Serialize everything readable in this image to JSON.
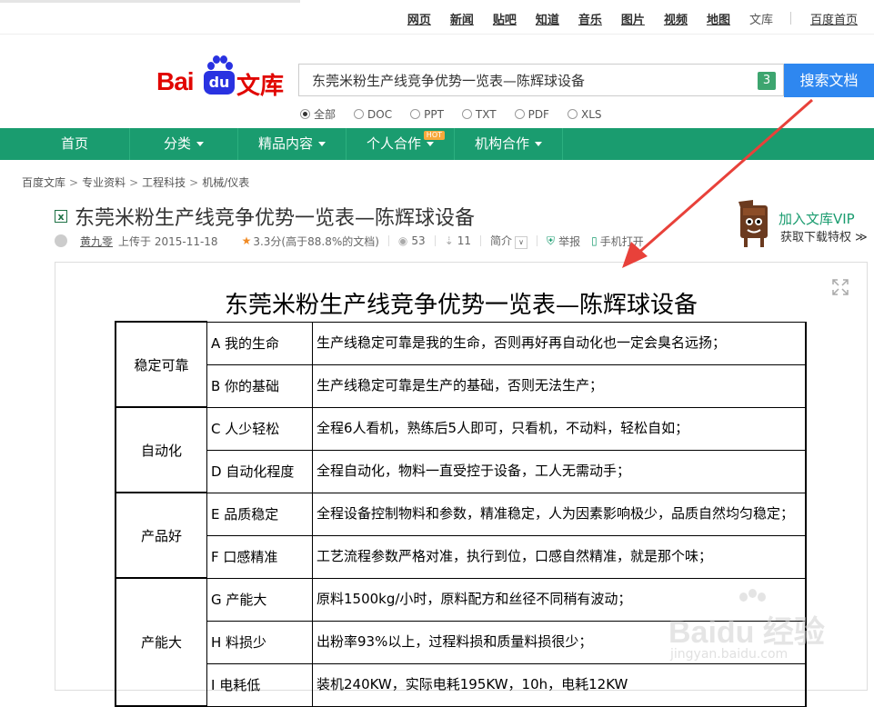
{
  "topnav": {
    "links": [
      "网页",
      "新闻",
      "贴吧",
      "知道",
      "音乐",
      "图片",
      "视频",
      "地图"
    ],
    "wenku": "文库",
    "baidu_home": "百度首页"
  },
  "logo": {
    "bai": "Bai",
    "du": "du",
    "wenku": "文库"
  },
  "search": {
    "value": "东莞米粉生产线竞争优势一览表—陈辉球设备",
    "badge": "3",
    "button": "搜索文档"
  },
  "filters": [
    {
      "label": "全部",
      "checked": true
    },
    {
      "label": "DOC",
      "checked": false
    },
    {
      "label": "PPT",
      "checked": false
    },
    {
      "label": "TXT",
      "checked": false
    },
    {
      "label": "PDF",
      "checked": false
    },
    {
      "label": "XLS",
      "checked": false
    }
  ],
  "greennav": {
    "home": "首页",
    "category": "分类",
    "featured": "精品内容",
    "personal": "个人合作",
    "hot_badge": "HOT",
    "org": "机构合作"
  },
  "breadcrumb": [
    "百度文库",
    "专业资料",
    "工程科技",
    "机械/仪表"
  ],
  "doc": {
    "type_icon": "x",
    "title": "东莞米粉生产线竞争优势一览表—陈辉球设备",
    "author": "黄九零",
    "uploaded": "上传于 2015-11-18",
    "rating": "3.3分(高于88.8%的文档)",
    "views": "53",
    "downloads": "11",
    "intro": "简介",
    "report": "举报",
    "mobile": "手机打开"
  },
  "vip": {
    "title": "加入文库VIP",
    "subtitle": "获取下载特权 ≫"
  },
  "sheet": {
    "title": "东莞米粉生产线竞争优势一览表—陈辉球设备",
    "groups": [
      {
        "category": "稳定可靠",
        "rows": [
          {
            "item": "A 我的生命",
            "desc": "生产线稳定可靠是我的生命，否则再好再自动化也一定会臭名远扬；"
          },
          {
            "item": "B 你的基础",
            "desc": "生产线稳定可靠是生产的基础，否则无法生产；"
          }
        ]
      },
      {
        "category": "自动化",
        "rows": [
          {
            "item": "C 人少轻松",
            "desc": "全程6人看机，熟练后5人即可，只看机，不动料，轻松自如；"
          },
          {
            "item": "D 自动化程度",
            "desc": "全程自动化，物料一直受控于设备，工人无需动手；"
          }
        ]
      },
      {
        "category": "产品好",
        "rows": [
          {
            "item": "E 品质稳定",
            "desc": "全程设备控制物料和参数，精准稳定，人为因素影响极少，品质自然均匀稳定；"
          },
          {
            "item": "F 口感精准",
            "desc": "工艺流程参数严格对准，执行到位，口感自然精准，就是那个味；"
          }
        ]
      },
      {
        "category": "产能大",
        "rows": [
          {
            "item": "G 产能大",
            "desc": "原料1500kg/小时，原料配方和丝径不同稍有波动；"
          },
          {
            "item": "H 料损少",
            "desc": "出粉率93%以上，过程料损和质量料损很少；"
          },
          {
            "item": "I 电耗低",
            "desc": "装机240KW，实际电耗195KW，10h，电耗12KW"
          }
        ]
      }
    ]
  },
  "watermark": {
    "brand": "Baidu 经验",
    "url": "jingyan.baidu.com"
  },
  "colors": {
    "green": "#1a9c6f",
    "blue": "#2e87f0",
    "red": "#e10601",
    "arrow": "#e8413a"
  }
}
